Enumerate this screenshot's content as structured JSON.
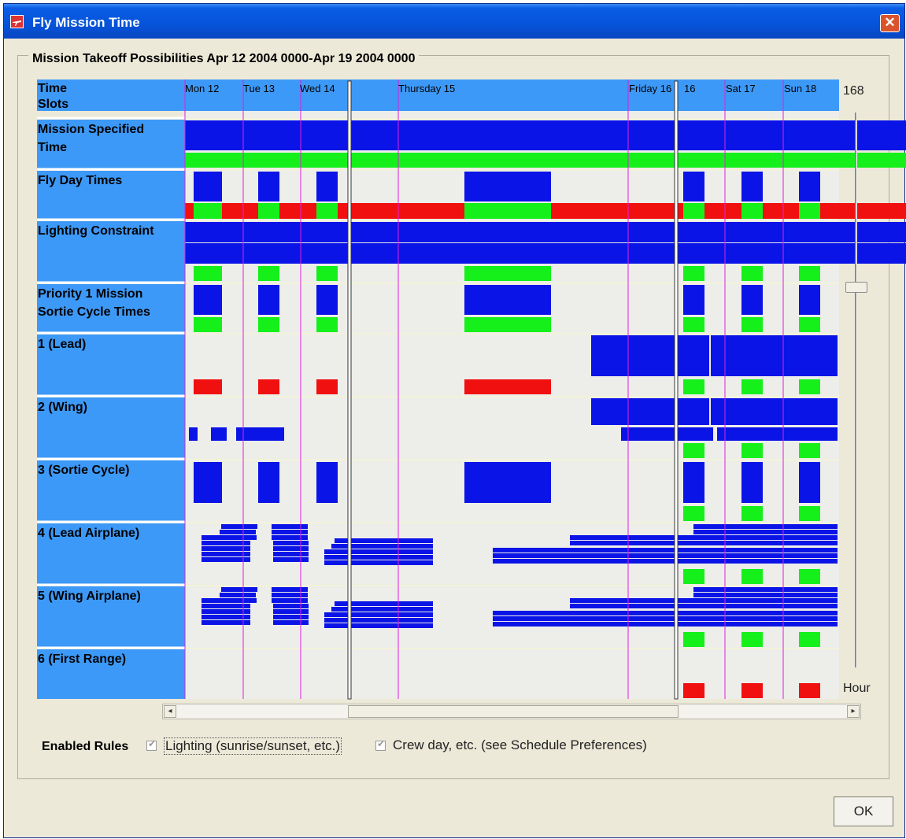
{
  "window": {
    "title": "Fly Mission Time",
    "close_glyph": "✕"
  },
  "group_title": "Mission Takeoff Possibilities Apr 12 2004 0000-Apr 19 2004 0000",
  "rows": [
    {
      "label_lines": [
        "Time",
        "Slots"
      ]
    },
    {
      "label_lines": [
        "Mission Specified",
        "Time"
      ]
    },
    {
      "label_lines": [
        "Fly Day Times"
      ]
    },
    {
      "label_lines": [
        "Lighting Constraint"
      ]
    },
    {
      "label_lines": [
        "Priority 1 Mission",
        "Sortie Cycle Times"
      ]
    },
    {
      "label_lines": [
        "1 (Lead)"
      ]
    },
    {
      "label_lines": [
        "2 (Wing)"
      ]
    },
    {
      "label_lines": [
        "3 (Sortie Cycle)"
      ]
    },
    {
      "label_lines": [
        "4 (Lead Airplane)"
      ]
    },
    {
      "label_lines": [
        "5 (Wing Airplane)"
      ]
    },
    {
      "label_lines": [
        "6 (First Range)"
      ]
    }
  ],
  "time_ticks": [
    "Mon 12",
    "Tue 13",
    "Wed 14",
    "Thursday 15",
    "Friday 16",
    "16",
    "Sat 17",
    "Sun 18"
  ],
  "slider": {
    "top_label": "168",
    "bottom_label": "Hour"
  },
  "enabled_rules": {
    "label": "Enabled Rules",
    "rules": [
      {
        "label": "Lighting (sunrise/sunset, etc.)",
        "checked": true
      },
      {
        "label": "Crew day, etc. (see Schedule Preferences)",
        "checked": true
      }
    ]
  },
  "ok_button": "OK",
  "colors": {
    "blue": "#0b14e6",
    "green": "#15f01a",
    "red": "#f01010",
    "label_bg": "#3d99f7",
    "grid_bg": "#ededea",
    "day_line": "#e020e0"
  },
  "icons": [
    "app-icon",
    "close-icon",
    "scroll-left-arrow-icon",
    "scroll-right-arrow-icon",
    "checkbox-icon"
  ]
}
